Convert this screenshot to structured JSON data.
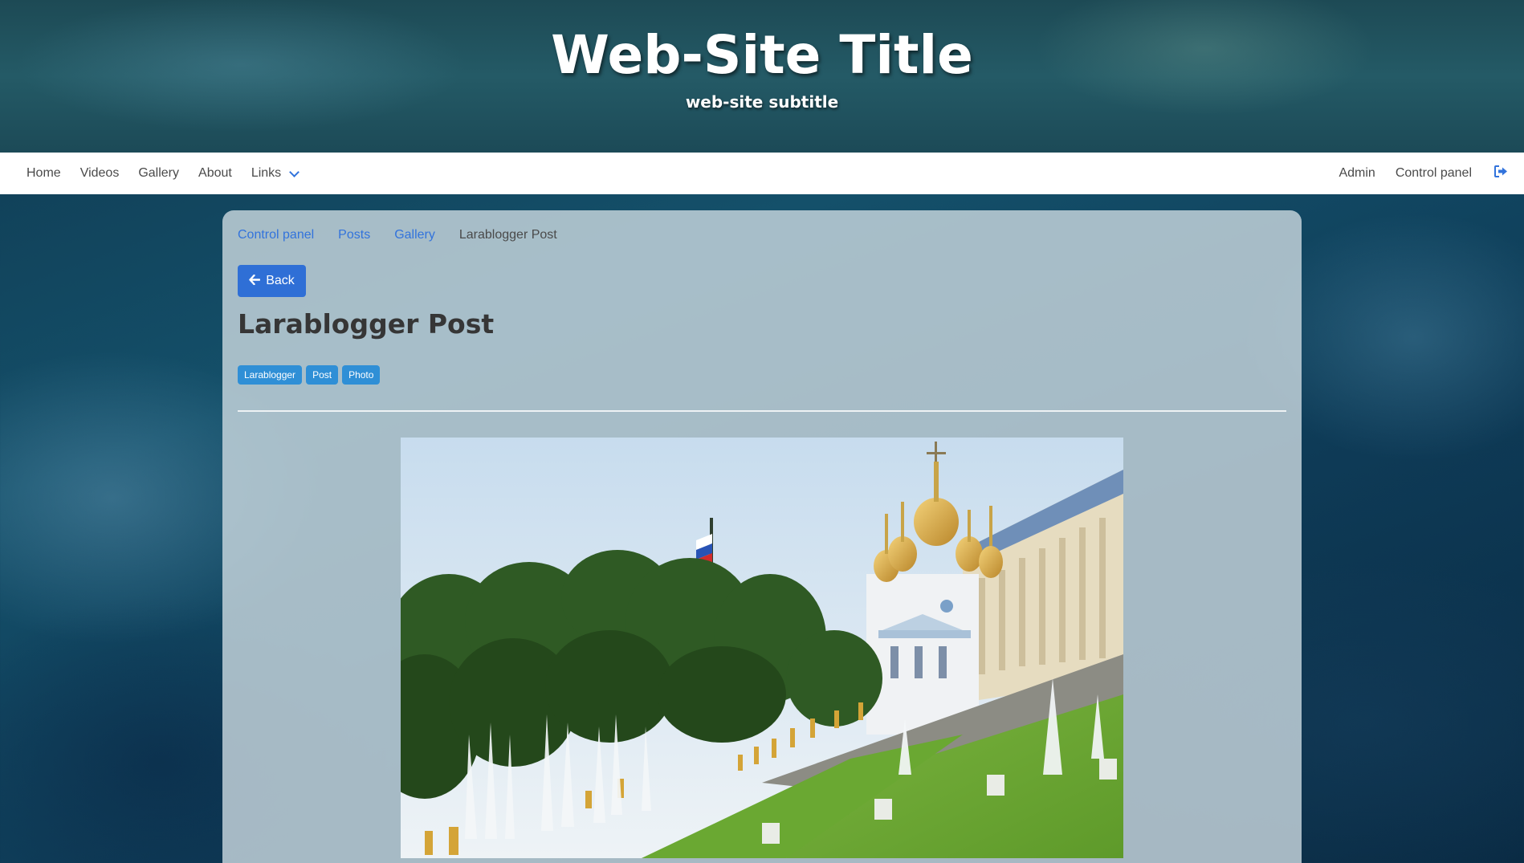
{
  "header": {
    "title": "Web-Site Title",
    "subtitle": "web-site subtitle"
  },
  "nav": {
    "left": [
      {
        "label": "Home"
      },
      {
        "label": "Videos"
      },
      {
        "label": "Gallery"
      },
      {
        "label": "About"
      },
      {
        "label": "Links"
      }
    ],
    "right": [
      {
        "label": "Admin"
      },
      {
        "label": "Control panel"
      }
    ],
    "logout_icon": "sign-out-icon"
  },
  "breadcrumb": {
    "items": [
      {
        "label": "Control panel"
      },
      {
        "label": "Posts"
      },
      {
        "label": "Gallery"
      }
    ],
    "current": "Larablogger Post"
  },
  "back_button": {
    "label": "Back",
    "icon": "arrow-left-icon"
  },
  "post": {
    "title": "Larablogger Post",
    "tags": [
      "Larablogger",
      "Post",
      "Photo"
    ],
    "image_subject": "palace with golden domes, fountains and flag on a green slope"
  },
  "colors": {
    "link": "#3273dc",
    "button": "#2f6fd6",
    "tag": "#2f8fd6",
    "title_text": "#363636"
  }
}
